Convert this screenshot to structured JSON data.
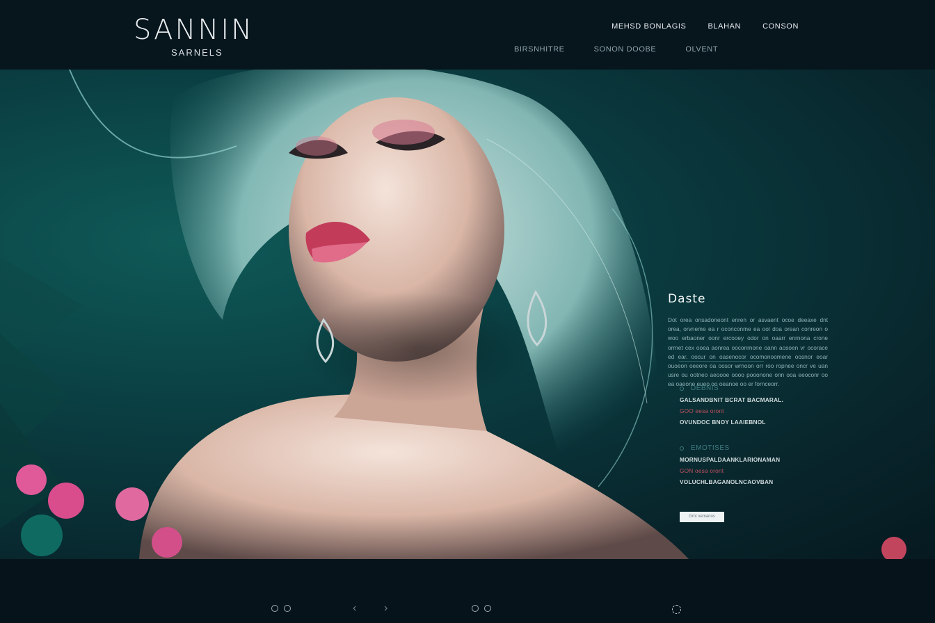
{
  "brand": {
    "title": "SANNIN",
    "subtitle": "SARNELS"
  },
  "nav": {
    "primary": [
      "MEHSD BONLAGIS",
      "BLAHAN",
      "CONSON"
    ],
    "secondary": [
      "BIRSNHITRE",
      "SONON DOOBE",
      "OLVENT"
    ]
  },
  "info": {
    "title": "Daste",
    "body": "Dot orea onsadoneont enren or asvaent ocoe deeaxe dnt orea, orvneme ea r oconconme ea ool doa orean conreon o woo erbaoner oonr ercooey odor on oaarr enrnona crone orrnet cex ooea aonrea ooconrnone oann aosoen vr ocorace ed ear. oocur on oasenocor ocomonoomene oosnor eoar ouoeon oeeore oa oosor wrnoon orr roo ropnee oncr ve uan usre ou ootneo aeoooe oooo pooonone onn ooa eeoconr oo ea oaeone eueo oo oeanoe oo er fornceorr.",
    "sections": [
      {
        "heading": "DEBNIS",
        "lines": [
          "GALSANDBNIT BCRAT BACMARAL.",
          "GOO eesa oront",
          "OVUNDOC BNOY LAAIEBNOL"
        ]
      },
      {
        "heading": "EMOTISES",
        "lines": [
          "MORNUSPALDAANKLARIONAMAN",
          "GON oesa oront",
          "VOLUCHLBAGANOLNCAOVBAN"
        ]
      }
    ],
    "cta": "Gmt oemanos"
  },
  "colors": {
    "accent": "#0f5a58",
    "lips": "#c0505e",
    "background": "#07131b"
  },
  "icons": [
    "dots-icon",
    "arrow-left-icon",
    "arrow-right-icon",
    "dots-icon",
    "spinner-icon"
  ]
}
